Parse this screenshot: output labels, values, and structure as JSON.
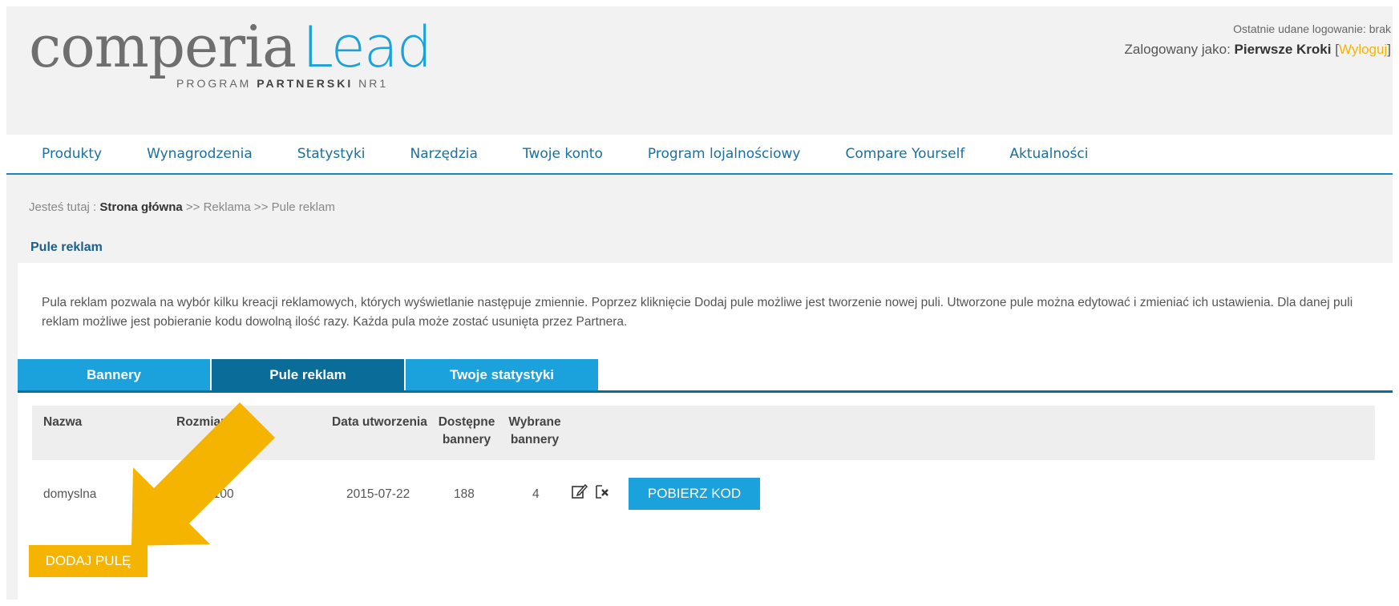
{
  "header": {
    "logo_main": "comperia",
    "logo_accent": "Lead",
    "logo_sub_prefix": "PROGRAM ",
    "logo_sub_bold": "PARTNERSKI",
    "logo_sub_suffix": " NR1",
    "last_login": "Ostatnie udane logowanie: brak",
    "logged_as_prefix": "Zalogowany jako: ",
    "user_name": "Pierwsze Kroki",
    "logout_open": " [",
    "logout": "Wyloguj",
    "logout_close": "]"
  },
  "nav": {
    "items": [
      {
        "label": "Produkty"
      },
      {
        "label": "Wynagrodzenia"
      },
      {
        "label": "Statystyki"
      },
      {
        "label": "Narzędzia"
      },
      {
        "label": "Twoje konto"
      },
      {
        "label": "Program lojalnościowy"
      },
      {
        "label": "Compare Yourself"
      },
      {
        "label": "Aktualności"
      }
    ]
  },
  "breadcrumb": {
    "prefix": "Jesteś tutaj : ",
    "home": "Strona główna",
    "rest": " >> Reklama >> Pule reklam"
  },
  "panel": {
    "title": "Pule reklam",
    "description": "Pula reklam pozwala na wybór kilku kreacji reklamowych, których wyświetlanie następuje zmiennie. Poprzez kliknięcie Dodaj pule możliwe jest tworzenie nowej puli. Utworzone pule można edytować i zmieniać ich ustawienia. Dla danej puli reklam możliwe jest pobieranie kodu dowolną ilość razy. Każda pula może zostać usunięta przez Partnera."
  },
  "tabs": [
    {
      "label": "Bannery",
      "active": false
    },
    {
      "label": "Pule reklam",
      "active": true
    },
    {
      "label": "Twoje statystyki",
      "active": false
    }
  ],
  "table": {
    "headers": {
      "name": "Nazwa",
      "size": "Rozmiar",
      "created": "Data utworzenia",
      "available_1": "Dostępne",
      "available_2": "bannery",
      "selected_1": "Wybrane",
      "selected_2": "bannery"
    },
    "rows": [
      {
        "name": "domyslna",
        "size": "x100",
        "created": "2015-07-22",
        "available": "188",
        "selected": "4",
        "edit_icon": "edit-icon",
        "delete_icon": "delete-icon",
        "code_button": "POBIERZ KOD"
      }
    ]
  },
  "add_button": "DODAJ PULĘ",
  "colors": {
    "brand_blue": "#1ba1db",
    "dark_blue": "#0a6c98",
    "accent_yellow": "#f5b400"
  }
}
